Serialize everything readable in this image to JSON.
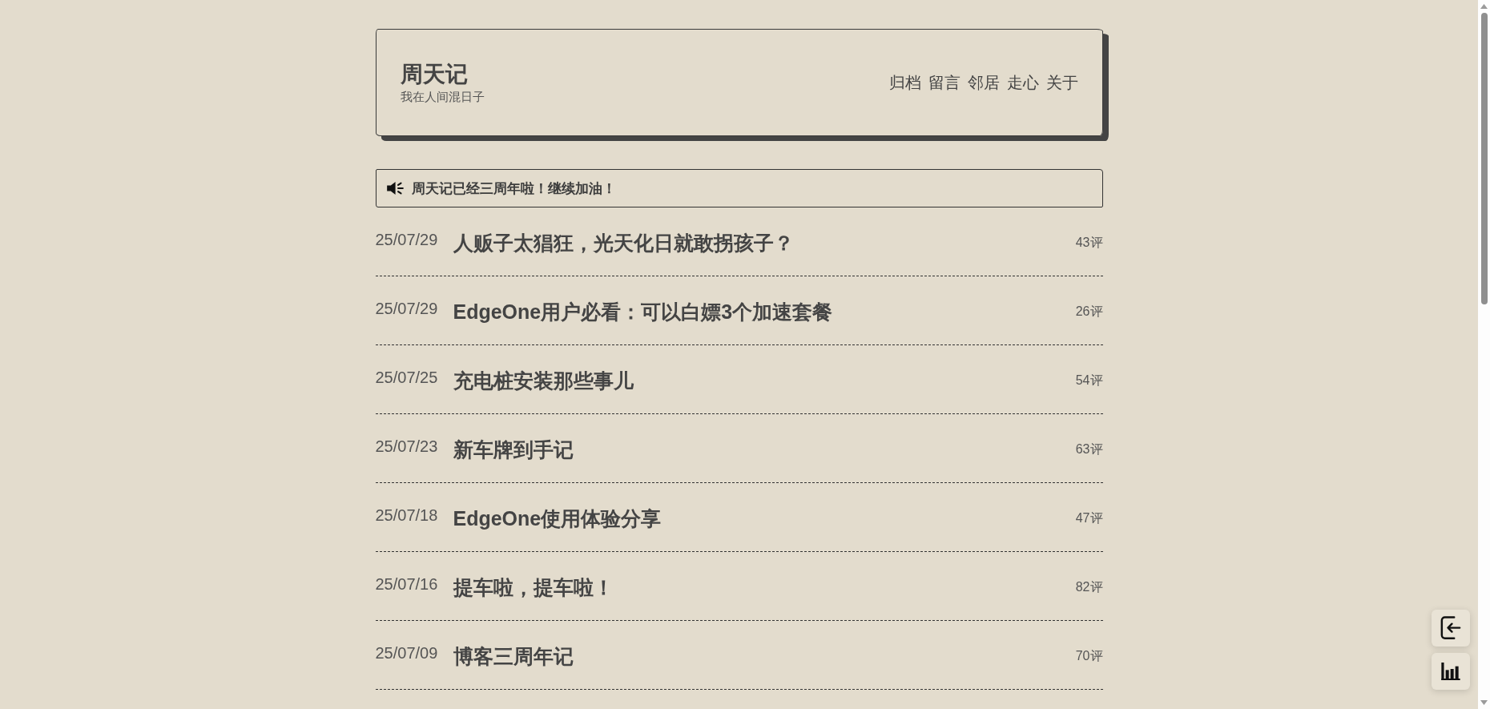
{
  "site": {
    "title": "周天记",
    "tagline": "我在人间混日子"
  },
  "nav": [
    "归档",
    "留言",
    "邻居",
    "走心",
    "关于"
  ],
  "announcement": {
    "text": "周天记已经三周年啦！继续加油！"
  },
  "posts": [
    {
      "date": "25/07/29",
      "title": "人贩子太猖狂，光天化日就敢拐孩子？",
      "comments": "43评"
    },
    {
      "date": "25/07/29",
      "title": "EdgeOne用户必看：可以白嫖3个加速套餐",
      "comments": "26评"
    },
    {
      "date": "25/07/25",
      "title": "充电桩安装那些事儿",
      "comments": "54评"
    },
    {
      "date": "25/07/23",
      "title": "新车牌到手记",
      "comments": "63评"
    },
    {
      "date": "25/07/18",
      "title": "EdgeOne使用体验分享",
      "comments": "47评"
    },
    {
      "date": "25/07/16",
      "title": "提车啦，提车啦！",
      "comments": "82评"
    },
    {
      "date": "25/07/09",
      "title": "博客三周年记",
      "comments": "70评"
    }
  ],
  "floating_buttons": [
    {
      "kind": "login"
    },
    {
      "kind": "stats"
    }
  ]
}
